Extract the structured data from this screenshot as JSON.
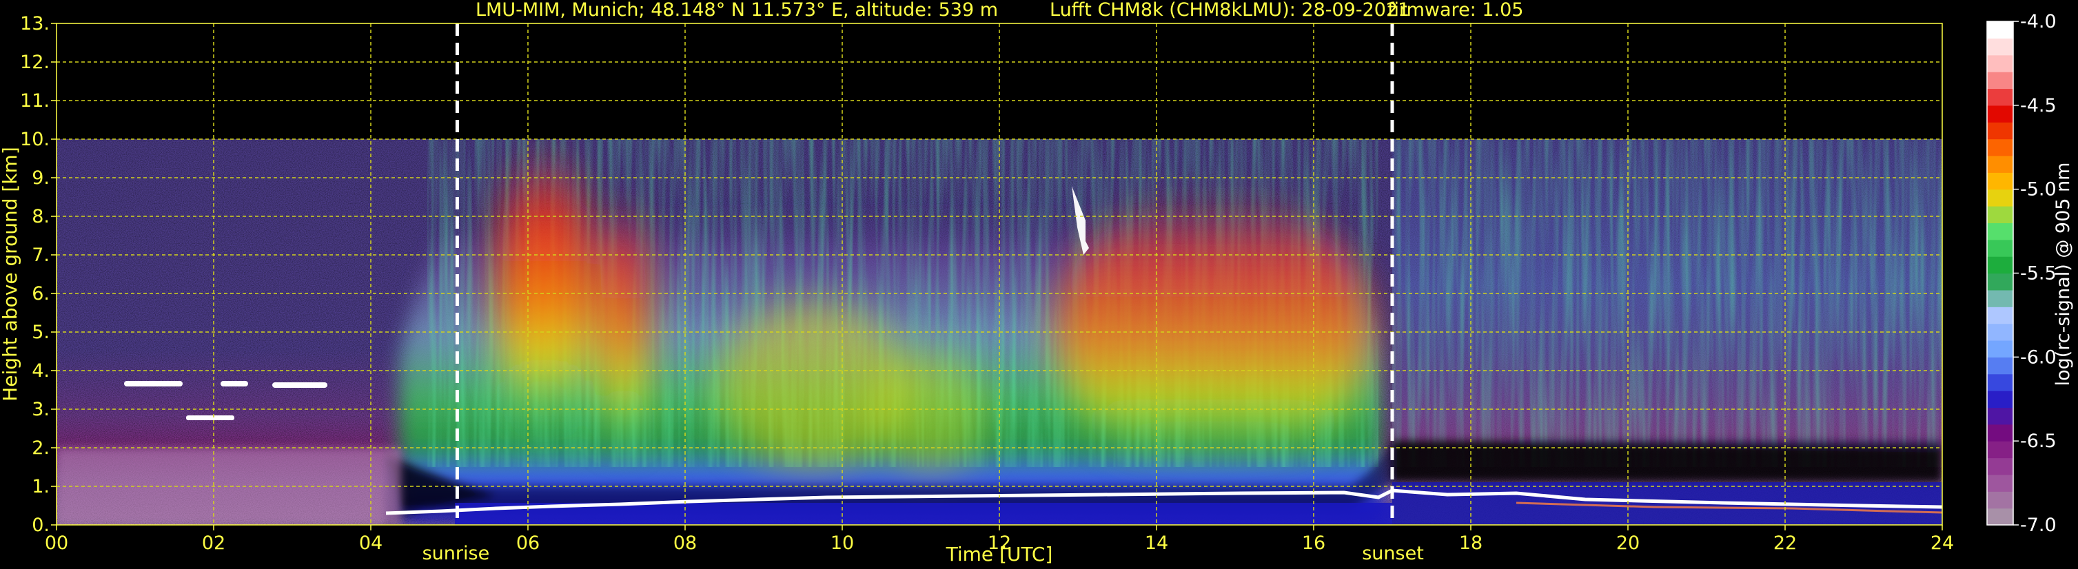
{
  "chart_data": {
    "type": "heatmap",
    "title": {
      "site": "LMU-MIM, Munich; 48.148° N 11.573° E, altitude: 539 m",
      "instrument": "Lufft CHM8k (CHM8kLMU): 28-09-2021",
      "firmware": "firmware: 1.05"
    },
    "xlabel": "Time [UTC]",
    "ylabel": "Height above ground [km]",
    "xlim": [
      0,
      24
    ],
    "ylim": [
      0,
      13
    ],
    "x_ticks": [
      "00",
      "02",
      "04",
      "06",
      "08",
      "10",
      "12",
      "14",
      "16",
      "18",
      "20",
      "22",
      "24"
    ],
    "y_ticks": [
      "0.",
      "1.",
      "2.",
      "3.",
      "4.",
      "5.",
      "6.",
      "7.",
      "8.",
      "9.",
      "10.",
      "11.",
      "12.",
      "13."
    ],
    "grid": true,
    "data_top_km": 10,
    "annotations": [
      {
        "label": "sunrise",
        "x": 5.1
      },
      {
        "label": "sunset",
        "x": 17.0
      }
    ],
    "colorbar": {
      "label": "log(rc-signal) @ 905 nm",
      "range": [
        -7.0,
        -4.0
      ],
      "ticks": [
        "-4.0",
        "-4.5",
        "-5.0",
        "-5.5",
        "-6.0",
        "-6.5",
        "-7.0"
      ]
    },
    "profile_layers": [
      {
        "name": "surface aerosol layer top",
        "times": [
          0,
          4,
          5,
          6,
          8,
          12,
          16,
          17,
          20,
          24
        ],
        "km": [
          0.5,
          0.5,
          0.35,
          0.4,
          0.45,
          0.6,
          0.7,
          0.8,
          0.7,
          0.6
        ]
      },
      {
        "name": "boundary layer top",
        "times": [
          4.5,
          5.5,
          6.5,
          8,
          10,
          12,
          14,
          16,
          17
        ],
        "km": [
          0.5,
          1.2,
          1.6,
          1.8,
          1.9,
          2.0,
          2.0,
          1.9,
          1.0
        ]
      }
    ],
    "clouds": [
      {
        "x": [
          0.9,
          2.0
        ],
        "km": 3.65
      },
      {
        "x": [
          1.7,
          2.3
        ],
        "km": 2.75
      },
      {
        "x": [
          2.1,
          2.8
        ],
        "km": 3.6
      },
      {
        "x": [
          13.0,
          13.3
        ],
        "km": [
          7.5,
          8.7
        ]
      }
    ]
  },
  "colors": {
    "background": "#000000",
    "text": "#ffff44",
    "grid": "#d4d41a",
    "colorbar_stops": [
      "#a890a8",
      "#9c4a9c",
      "#7a0a7a",
      "#2020d0",
      "#6aa0ff",
      "#b0c8ff",
      "#10a030",
      "#50e070",
      "#ffd000",
      "#ff7000",
      "#e00000",
      "#ffb0b0",
      "#ffffff"
    ]
  }
}
